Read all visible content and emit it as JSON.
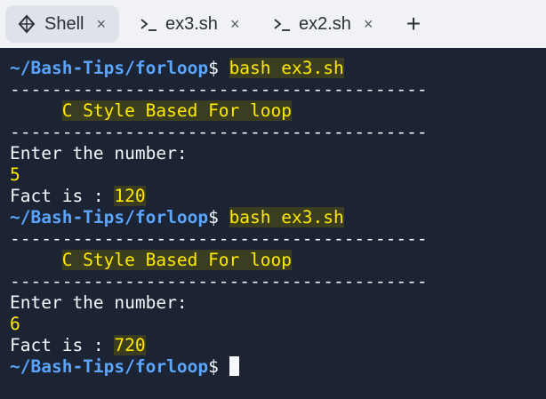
{
  "tabs": [
    {
      "label": "Shell",
      "close": "×",
      "icon": "shell-icon",
      "active": true
    },
    {
      "label": "ex3.sh",
      "close": "×",
      "icon": "terminal-icon",
      "active": false
    },
    {
      "label": "ex2.sh",
      "close": "×",
      "icon": "terminal-icon",
      "active": false
    }
  ],
  "add_tab": "+",
  "terminal": {
    "prompt": "~/Bash-Tips/forloop",
    "dollar": "$",
    "command": "bash ex3.sh",
    "dashes": "----------------------------------------",
    "banner": "C Style Based For loop",
    "enter_prompt": "Enter the number:",
    "fact_label": "Fact is : ",
    "runs": [
      {
        "input": "5",
        "result": "120"
      },
      {
        "input": "6",
        "result": "720"
      }
    ]
  },
  "colors": {
    "background": "#1c2333",
    "prompt": "#5aa6ff",
    "highlight": "#ffea00"
  }
}
